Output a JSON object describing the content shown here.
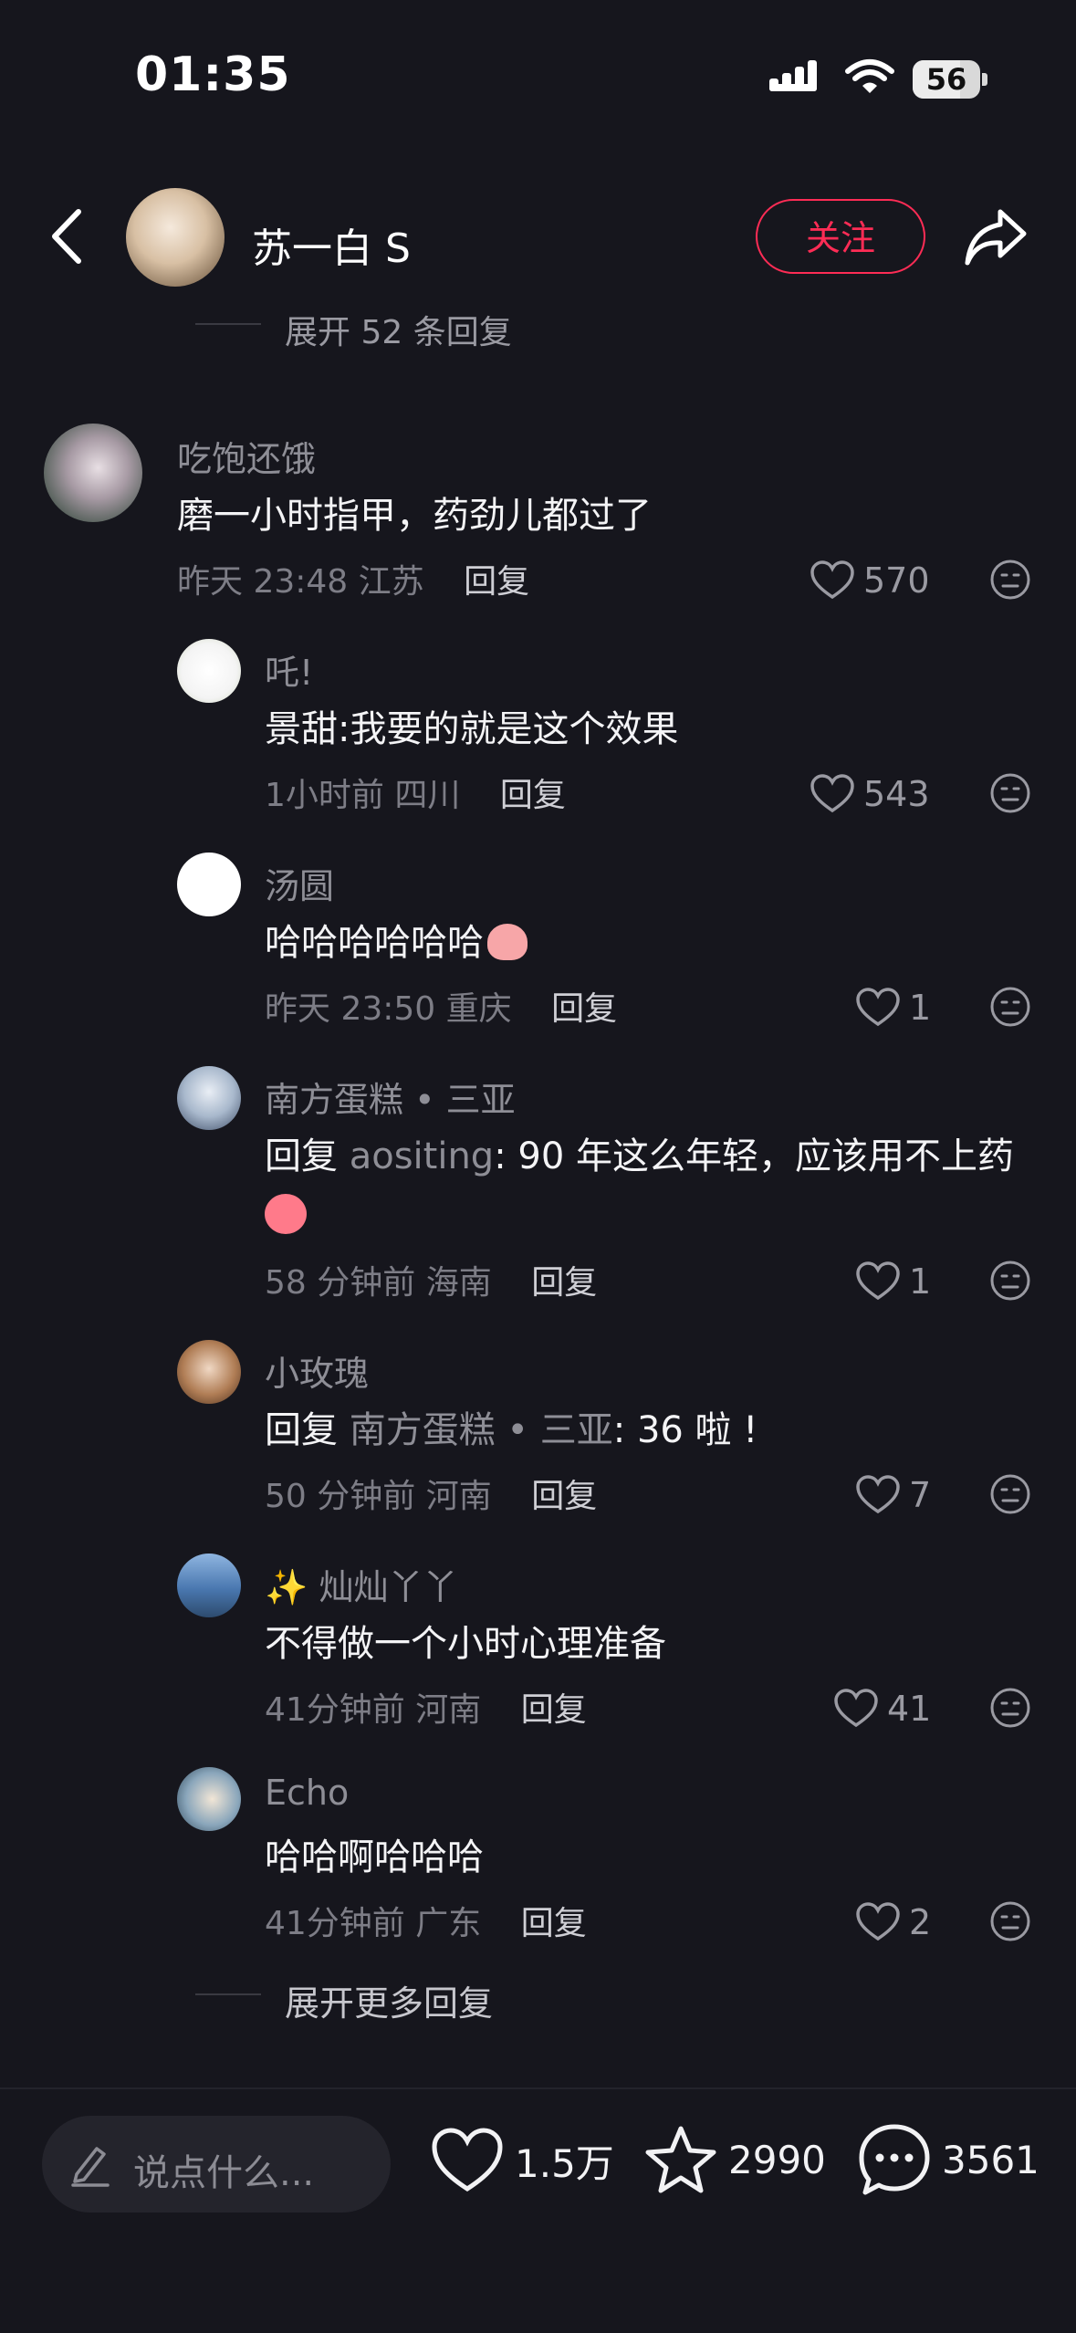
{
  "status_bar": {
    "time": "01:35",
    "battery": "56"
  },
  "header": {
    "author_name": "苏一白 S",
    "follow_label": "关注"
  },
  "collapse_label": "展开 52 条回复",
  "comments": [
    {
      "name": "吃饱还饿",
      "text": "磨一小时指甲，药劲儿都过了",
      "time": "昨天 23:48",
      "location": "江苏",
      "reply_label": "回复",
      "likes": "570"
    },
    {
      "name": "吒!",
      "text": "景甜:我要的就是这个效果",
      "time": "1小时前",
      "location": "四川",
      "reply_label": "回复",
      "likes": "543"
    },
    {
      "name": "汤圆",
      "text": "哈哈哈哈哈哈",
      "time": "昨天 23:50",
      "location": "重庆",
      "reply_label": "回复",
      "likes": "1"
    },
    {
      "name": "南方蛋糕 • 三亚",
      "reply_prefix": "回复",
      "mention": "aositing",
      "text": ": 90 年这么年轻，应该用不上药",
      "time": "58 分钟前",
      "location": "海南",
      "reply_label": "回复",
      "likes": "1"
    },
    {
      "name": "小玫瑰",
      "reply_prefix": "回复",
      "mention": "南方蛋糕 • 三亚",
      "text": ": 36 啦 !",
      "time": "50 分钟前",
      "location": "河南",
      "reply_label": "回复",
      "likes": "7"
    },
    {
      "name": "✨ 灿灿丫丫",
      "text": "不得做一个小时心理准备",
      "time": "41分钟前",
      "location": "河南",
      "reply_label": "回复",
      "likes": "41"
    },
    {
      "name": "Echo",
      "text": "哈哈啊哈哈哈",
      "time": "41分钟前",
      "location": "广东",
      "reply_label": "回复",
      "likes": "2"
    }
  ],
  "more_replies_label": "展开更多回复",
  "bottom_bar": {
    "input_placeholder": "说点什么...",
    "likes": "1.5万",
    "favorites": "2990",
    "comments": "3561"
  },
  "colors": {
    "accent": "#fe2c55",
    "background": "#16161d"
  },
  "icons": [
    "back-icon",
    "share-icon",
    "heart-icon",
    "dislike-face-icon",
    "edit-icon",
    "star-icon",
    "comment-bubble-icon",
    "signal-icon",
    "wifi-icon",
    "battery-icon"
  ]
}
